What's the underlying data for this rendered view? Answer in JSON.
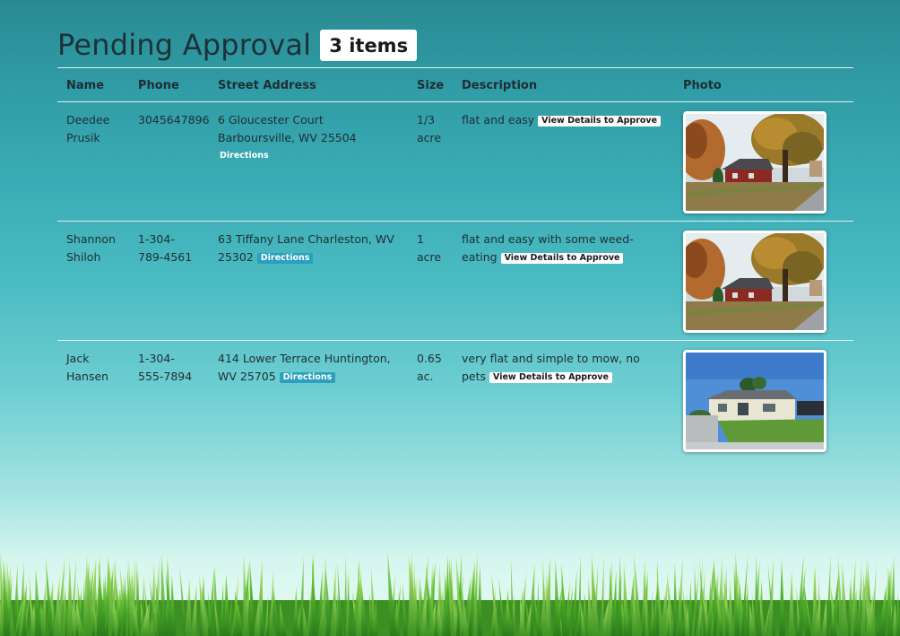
{
  "header": {
    "title": "Pending Approval",
    "count_label": "3 items"
  },
  "table": {
    "columns": [
      "Name",
      "Phone",
      "Street Address",
      "Size",
      "Description",
      "Photo"
    ],
    "rows": [
      {
        "name": "Deedee Prusik",
        "phone": "3045647896",
        "address": "6 Gloucester Court Barboursville, WV 25504",
        "directions_label": "Directions",
        "size": "1/3 acre",
        "description": "flat and easy",
        "approve_label": "View Details to Approve",
        "photo_icon": "house-autumn-photo"
      },
      {
        "name": "Shannon Shiloh",
        "phone": "1-304-789-4561",
        "address": "63 Tiffany Lane Charleston, WV 25302",
        "directions_label": "Directions",
        "size": "1 acre",
        "description": "flat and easy with some weed-eating",
        "approve_label": "View Details to Approve",
        "photo_icon": "house-autumn-photo"
      },
      {
        "name": "Jack Hansen",
        "phone": "1-304-555-7894",
        "address": "414 Lower Terrace Huntington, WV 25705",
        "directions_label": "Directions",
        "size": "0.65 ac.",
        "description": "very flat and simple to mow, no pets",
        "approve_label": "View Details to Approve",
        "photo_icon": "house-summer-photo"
      }
    ]
  }
}
